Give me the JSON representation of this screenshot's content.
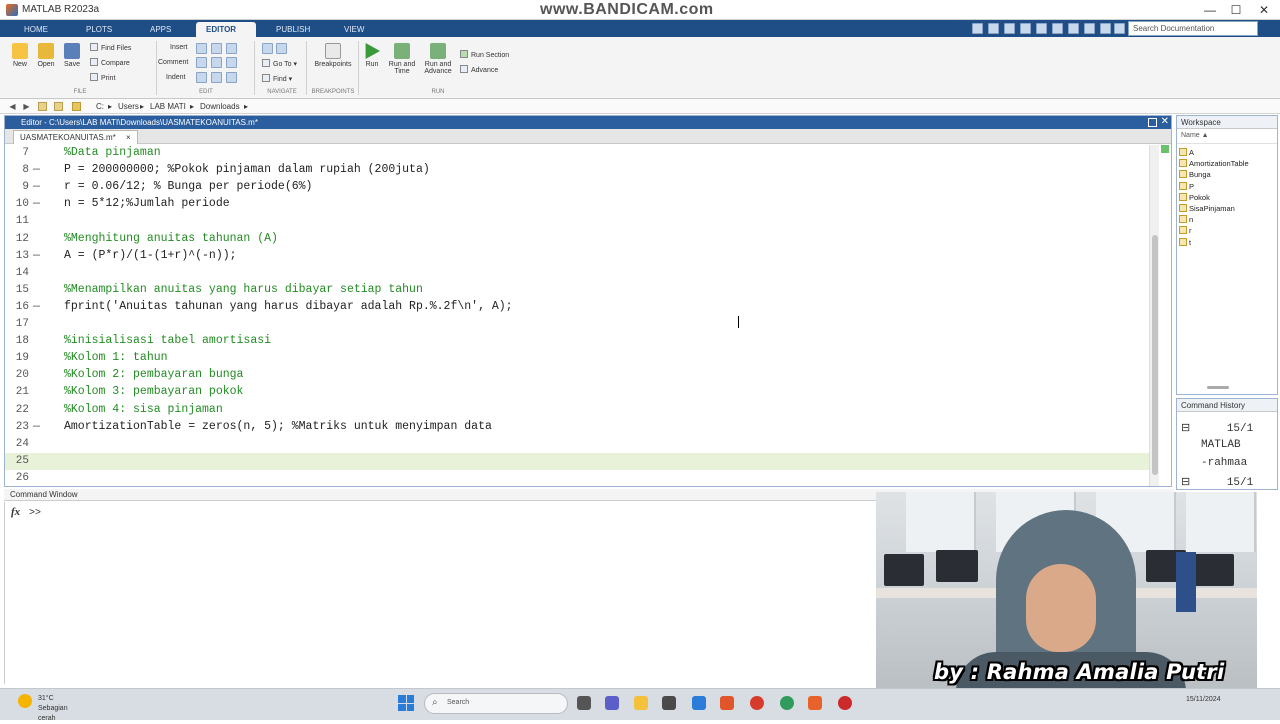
{
  "titlebar": {
    "title": "MATLAB R2023a",
    "watermark": "www.BANDICAM.com",
    "minimize": "—",
    "maximize": "☐",
    "close": "✕"
  },
  "ribbon_tabs": [
    "HOME",
    "PLOTS",
    "APPS",
    "EDITOR",
    "PUBLISH",
    "VIEW"
  ],
  "search_doc": "Search Documentation",
  "ribbon": {
    "file": {
      "new": "New",
      "open": "Open",
      "save": "Save",
      "find_files": "Find Files",
      "compare": "Compare",
      "print": "Print",
      "group": "FILE"
    },
    "edit": {
      "insert": "Insert",
      "comment": "Comment",
      "indent": "Indent",
      "group": "EDIT"
    },
    "navigate": {
      "go_to": "Go To",
      "find": "Find",
      "group": "NAVIGATE"
    },
    "breakpoints": {
      "label": "Breakpoints",
      "group": "BREAKPOINTS"
    },
    "run": {
      "run": "Run",
      "run_and_time": "Run and Time",
      "run_and_advance": "Run and Advance",
      "run_section": "Run Section",
      "advance": "Advance",
      "group": "RUN"
    }
  },
  "address": {
    "crumbs": [
      "C:",
      "Users",
      "LAB MATI",
      "Downloads"
    ]
  },
  "editor": {
    "title": "Editor - C:\\Users\\LAB MATI\\Downloads\\UASMATEKOANUITAS.m*",
    "tab": "UASMATEKOANUITAS.m*",
    "lines": [
      {
        "num": "7",
        "mark": "",
        "text": "%Data pinjaman",
        "comment": true
      },
      {
        "num": "8",
        "mark": "—",
        "text": "P = 200000000; %Pokok pinjaman dalam rupiah (200juta)",
        "comment": false
      },
      {
        "num": "9",
        "mark": "—",
        "text": "r = 0.06/12; % Bunga per periode(6%)",
        "comment": false
      },
      {
        "num": "10",
        "mark": "—",
        "text": "n = 5*12;%Jumlah periode",
        "comment": false
      },
      {
        "num": "11",
        "mark": "",
        "text": "",
        "comment": false
      },
      {
        "num": "12",
        "mark": "",
        "text": "%Menghitung anuitas tahunan (A)",
        "comment": true
      },
      {
        "num": "13",
        "mark": "—",
        "text": "A = (P*r)/(1-(1+r)^(-n));",
        "comment": false
      },
      {
        "num": "14",
        "mark": "",
        "text": "",
        "comment": false
      },
      {
        "num": "15",
        "mark": "",
        "text": "%Menampilkan anuitas yang harus dibayar setiap tahun",
        "comment": true
      },
      {
        "num": "16",
        "mark": "—",
        "text": "fprint('Anuitas tahunan yang harus dibayar adalah Rp.%.2f\\n', A);",
        "comment": false
      },
      {
        "num": "17",
        "mark": "",
        "text": "",
        "comment": false
      },
      {
        "num": "18",
        "mark": "",
        "text": "%inisialisasi tabel amortisasi",
        "comment": true
      },
      {
        "num": "19",
        "mark": "",
        "text": "%Kolom 1: tahun",
        "comment": true
      },
      {
        "num": "20",
        "mark": "",
        "text": "%Kolom 2: pembayaran bunga",
        "comment": true
      },
      {
        "num": "21",
        "mark": "",
        "text": "%Kolom 3: pembayaran pokok",
        "comment": true
      },
      {
        "num": "22",
        "mark": "",
        "text": "%Kolom 4: sisa pinjaman",
        "comment": true
      },
      {
        "num": "23",
        "mark": "—",
        "text": "AmortizationTable = zeros(n, 5); %Matriks untuk menyimpan data",
        "comment": false
      },
      {
        "num": "24",
        "mark": "",
        "text": "",
        "comment": false
      },
      {
        "num": "25",
        "mark": "",
        "text": "",
        "comment": false,
        "current": true
      },
      {
        "num": "26",
        "mark": "",
        "text": "",
        "comment": false
      }
    ]
  },
  "workspace": {
    "title": "Workspace",
    "column": "Name ▲",
    "vars": [
      "A",
      "AmortizationTable",
      "Bunga",
      "P",
      "Pokok",
      "SisaPinjaman",
      "n",
      "r",
      "t"
    ]
  },
  "command_history": {
    "title": "Command History",
    "items": [
      "15/1",
      "MATLAB",
      "-rahmaa",
      "15/1"
    ]
  },
  "command_window": {
    "title": "Command Window",
    "fx": "fx",
    "prompt": ">>"
  },
  "webcam": {
    "caption": "by : Rahma Amalia Putri"
  },
  "taskbar": {
    "weather_temp": "31°C",
    "weather_desc": "Sebagian cerah",
    "search_placeholder": "Search",
    "clock": "15/11/2024"
  }
}
